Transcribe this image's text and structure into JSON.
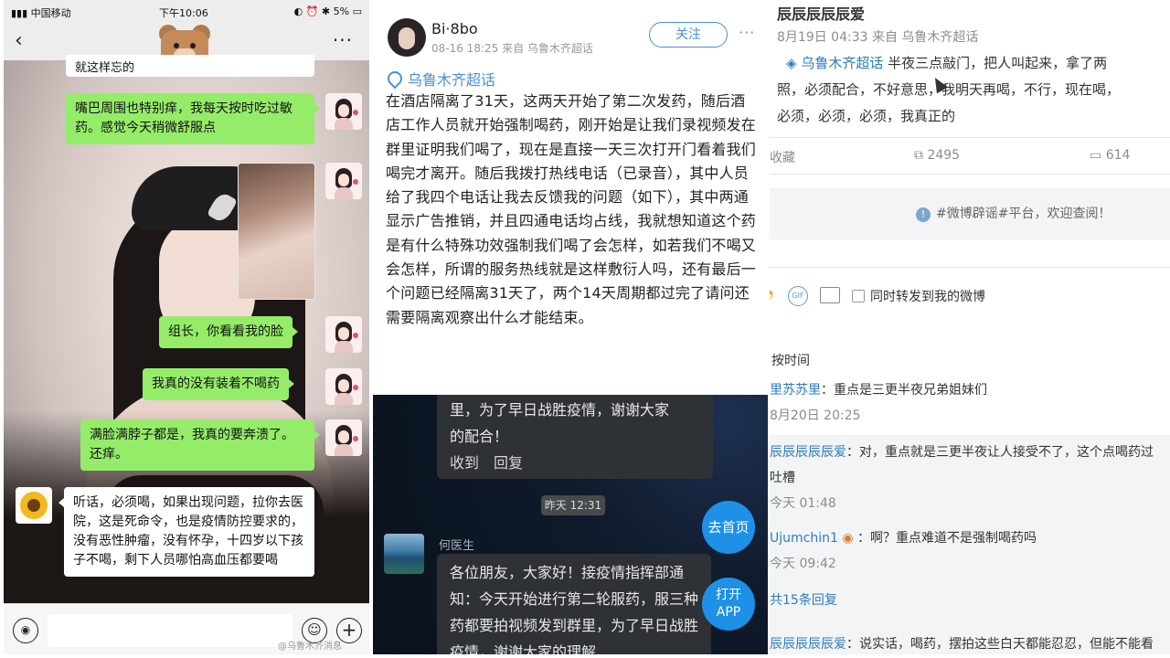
{
  "panel1": {
    "status": {
      "carrier": "中国移动",
      "time": "下午10:06",
      "battery": "5%"
    },
    "nav": {
      "back": "‹",
      "more": "···"
    },
    "messages": {
      "top_partial": "就这样忘的",
      "m1": "嘴巴周围也特别痒，我每天按时吃过敏药。感觉今天稍微舒服点",
      "m2": "组长，你看看我的脸",
      "m3": "我真的没有装着不喝药",
      "m4": "满脸满脖子都是，我真的要奔溃了。还痒。",
      "reply": "听话，必须喝，如果出现问题，拉你去医院，这是死命令，也是疫情防控要求的，没有恶性肿瘤，没有怀孕，十四岁以下孩子不喝，剩下人员哪怕高血压都要喝"
    },
    "watermark": "@乌鲁木齐消息"
  },
  "panel2": {
    "user": "Bi·8bo",
    "meta": "08-16 18:25 来自 乌鲁木齐超话",
    "follow": "关注",
    "more": "···",
    "topic": "乌鲁木齐超话",
    "body": "在酒店隔离了31天，这两天开始了第二次发药，随后酒店工作人员就开始强制喝药，刚开始是让我们录视频发在群里证明我们喝了，现在是直接一天三次打开门看着我们喝完才离开。随后我拨打热线电话（已录音），其中人员给了我四个电话让我去反馈我的问题（如下），其中两通显示广告推销，并且四通电话均占线，我就想知道这个药是有什么特殊功效强制我们喝了会怎样，如若我们不喝又会怎样，所谓的服务热线就是这样敷衍人吗，还有最后一个问题已经隔离31天了，两个14天周期都过完了请问还需要隔离观察出什么才能结束。",
    "chat": {
      "bubble_top_line1": "里，为了早日战胜疫情，谢谢大家",
      "bubble_top_line2": "的配合！",
      "bubble_top_actions": "收到　回复",
      "time": "昨天 12:31",
      "sender": "何医生",
      "msg": "各位朋友，大家好！接疫情指挥部通知：今天开始进行第二轮服药，服三种药都要拍视频发到群里，为了早日战胜疫情，谢谢大家的理解",
      "btn_home": "去首页",
      "btn_app": "打开APP"
    }
  },
  "panel3": {
    "user": "辰辰辰辰辰爱",
    "meta": "8月19日 04:33 来自 乌鲁木齐超话",
    "topic": "乌鲁木齐超话",
    "line1": "半夜三点敲门，把人叫起来，拿了两",
    "line2": "照，必须配合，不好意思，我明天再喝，不行，现在喝，",
    "line3": "必须，必须，必须，我真正的",
    "stats": {
      "collect": "收藏",
      "repost": "2495",
      "comments": "614"
    },
    "notice": "#微博辟谣#平台，欢迎查阅！",
    "composer": {
      "gif": "GIF",
      "repost_label": "同时转发到我的微博"
    },
    "sort": "按时间",
    "comments": [
      {
        "user": "里苏苏里",
        "text": "：重点是三更半夜兄弟姐妹们",
        "time": "8月20日 20:25"
      },
      {
        "user": "辰辰辰辰辰爱",
        "text": "：对，重点就是三更半夜让人接受不了，这个点喝药过",
        "text2": "吐槽",
        "time": "今天 01:48"
      },
      {
        "user": "Ujumchin1",
        "text": "：啊？重点难道不是强制喝药吗",
        "time": "今天 09:42"
      }
    ],
    "more_replies": "共15条回复",
    "last": {
      "user": "辰辰辰辰辰爱",
      "text": "：说实话，喝药，摆拍这些白天都能忍忍，但能不能看"
    }
  }
}
